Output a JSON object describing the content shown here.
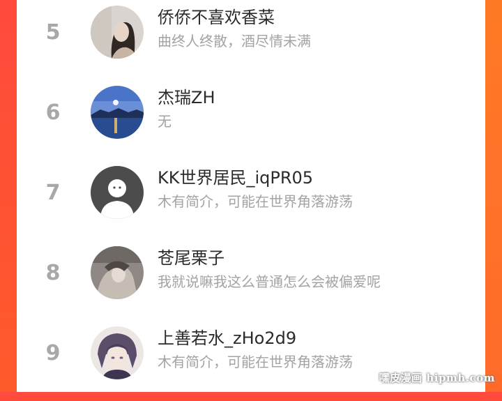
{
  "ranking": {
    "rows": [
      {
        "rank": "5",
        "name": "侨侨不喜欢香菜",
        "bio": "曲终人终散，酒尽情未满"
      },
      {
        "rank": "6",
        "name": "杰瑞ZH",
        "bio": "无"
      },
      {
        "rank": "7",
        "name": "KK世界居民_iqPR05",
        "bio": "木有简介，可能在世界角落游荡"
      },
      {
        "rank": "8",
        "name": "苍尾栗子",
        "bio": "我就说嘛我这么普通怎么会被偏爱呢"
      },
      {
        "rank": "9",
        "name": "上善若水_zHo2d9",
        "bio": "木有简介，可能在世界角落游荡"
      }
    ]
  },
  "watermark": "嘿皮漫画 hipmh.com",
  "colors": {
    "background": "#ff4a3d",
    "rank": "#a8a8a8",
    "name": "#2b2b2b",
    "bio": "#a3a3a3"
  }
}
